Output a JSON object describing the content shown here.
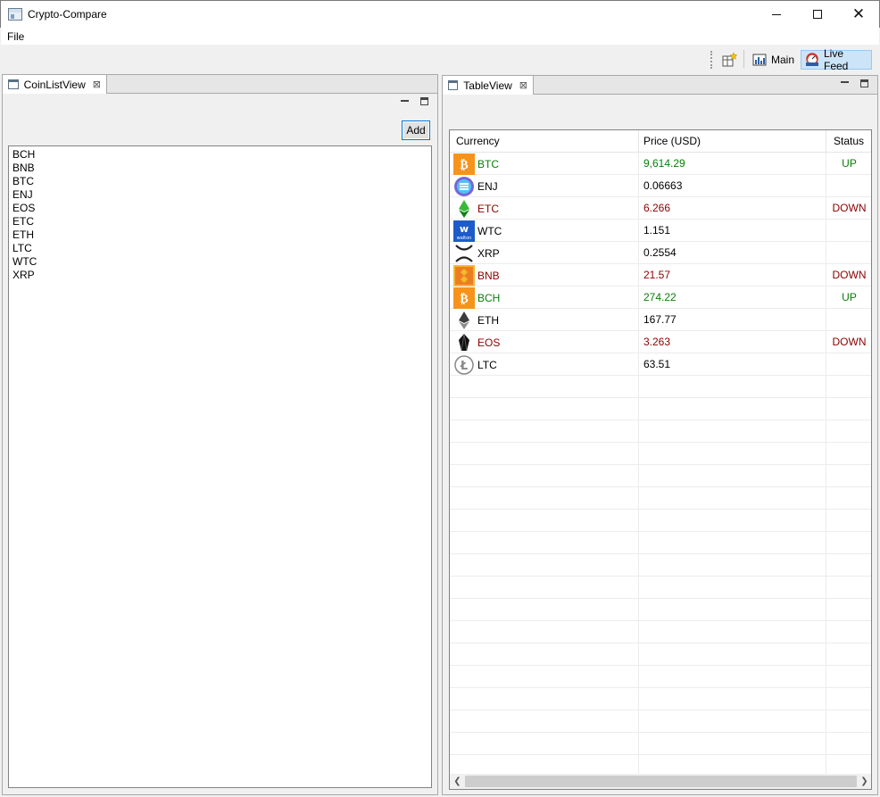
{
  "window": {
    "title": "Crypto-Compare"
  },
  "menu": {
    "file": "File"
  },
  "toolbar": {
    "main_label": "Main",
    "live_feed_label": "Live Feed"
  },
  "coin_list_view": {
    "tab_label": "CoinListView",
    "add_label": "Add",
    "items": [
      "BCH",
      "BNB",
      "BTC",
      "ENJ",
      "EOS",
      "ETC",
      "ETH",
      "LTC",
      "WTC",
      "XRP"
    ]
  },
  "table_view": {
    "tab_label": "TableView",
    "columns": {
      "currency": "Currency",
      "price": "Price (USD)",
      "status": "Status"
    },
    "rows": [
      {
        "currency": "BTC",
        "price": "9,614.29",
        "status": "UP",
        "trend": "up",
        "icon": "bitcoin-icon"
      },
      {
        "currency": "ENJ",
        "price": "0.06663",
        "status": "",
        "trend": "neutral",
        "icon": "enjin-icon"
      },
      {
        "currency": "ETC",
        "price": "6.266",
        "status": "DOWN",
        "trend": "down",
        "icon": "ethereum-classic-icon"
      },
      {
        "currency": "WTC",
        "price": "1.151",
        "status": "",
        "trend": "neutral",
        "icon": "walton-icon"
      },
      {
        "currency": "XRP",
        "price": "0.2554",
        "status": "",
        "trend": "neutral",
        "icon": "ripple-icon"
      },
      {
        "currency": "BNB",
        "price": "21.57",
        "status": "DOWN",
        "trend": "down",
        "icon": "binance-icon"
      },
      {
        "currency": "BCH",
        "price": "274.22",
        "status": "UP",
        "trend": "up",
        "icon": "bitcoin-cash-icon"
      },
      {
        "currency": "ETH",
        "price": "167.77",
        "status": "",
        "trend": "neutral",
        "icon": "ethereum-icon"
      },
      {
        "currency": "EOS",
        "price": "3.263",
        "status": "DOWN",
        "trend": "down",
        "icon": "eos-icon"
      },
      {
        "currency": "LTC",
        "price": "63.51",
        "status": "",
        "trend": "neutral",
        "icon": "litecoin-icon"
      }
    ]
  },
  "colors": {
    "up": "#0a7d0a",
    "down": "#8b0000",
    "selected_perspective": "#cce4f7"
  }
}
